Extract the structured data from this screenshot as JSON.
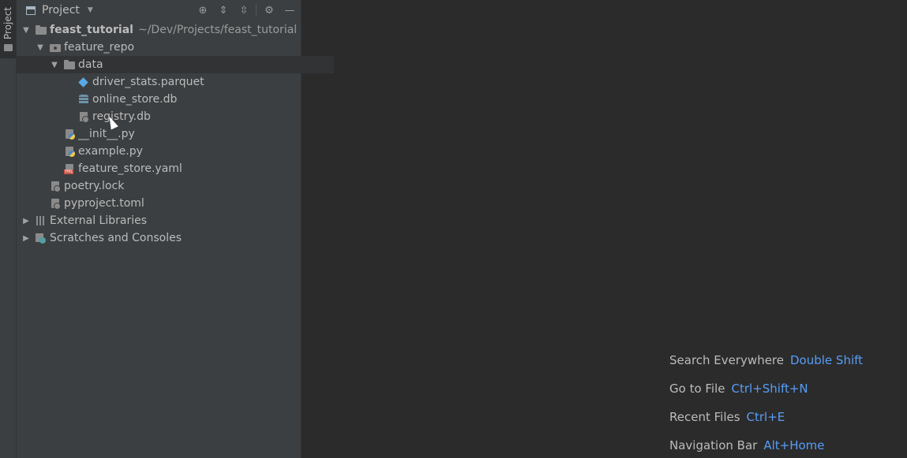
{
  "tool_strip": {
    "project_tab_label": "Project"
  },
  "panel": {
    "title": "Project",
    "buttons": [
      "locate-icon",
      "expand-all-icon",
      "collapse-all-icon",
      "gear-icon",
      "minimize-icon"
    ]
  },
  "tree": {
    "root": {
      "name": "feast_tutorial",
      "path": "~/Dev/Projects/feast_tutorial"
    },
    "feature_repo": "feature_repo",
    "data": "data",
    "driver_stats": "driver_stats.parquet",
    "online_store": "online_store.db",
    "registry": "registry.db",
    "init": "__init__.py",
    "example": "example.py",
    "feature_store_yaml": "feature_store.yaml",
    "poetry_lock": "poetry.lock",
    "pyproject": "pyproject.toml",
    "external_libraries": "External Libraries",
    "scratches": "Scratches and Consoles"
  },
  "hints": [
    {
      "label": "Search Everywhere",
      "key": "Double Shift"
    },
    {
      "label": "Go to File",
      "key": "Ctrl+Shift+N"
    },
    {
      "label": "Recent Files",
      "key": "Ctrl+E"
    },
    {
      "label": "Navigation Bar",
      "key": "Alt+Home"
    }
  ],
  "colors": {
    "background": "#2b2b2b",
    "panel": "#3c3f41",
    "accent": "#589df6"
  }
}
